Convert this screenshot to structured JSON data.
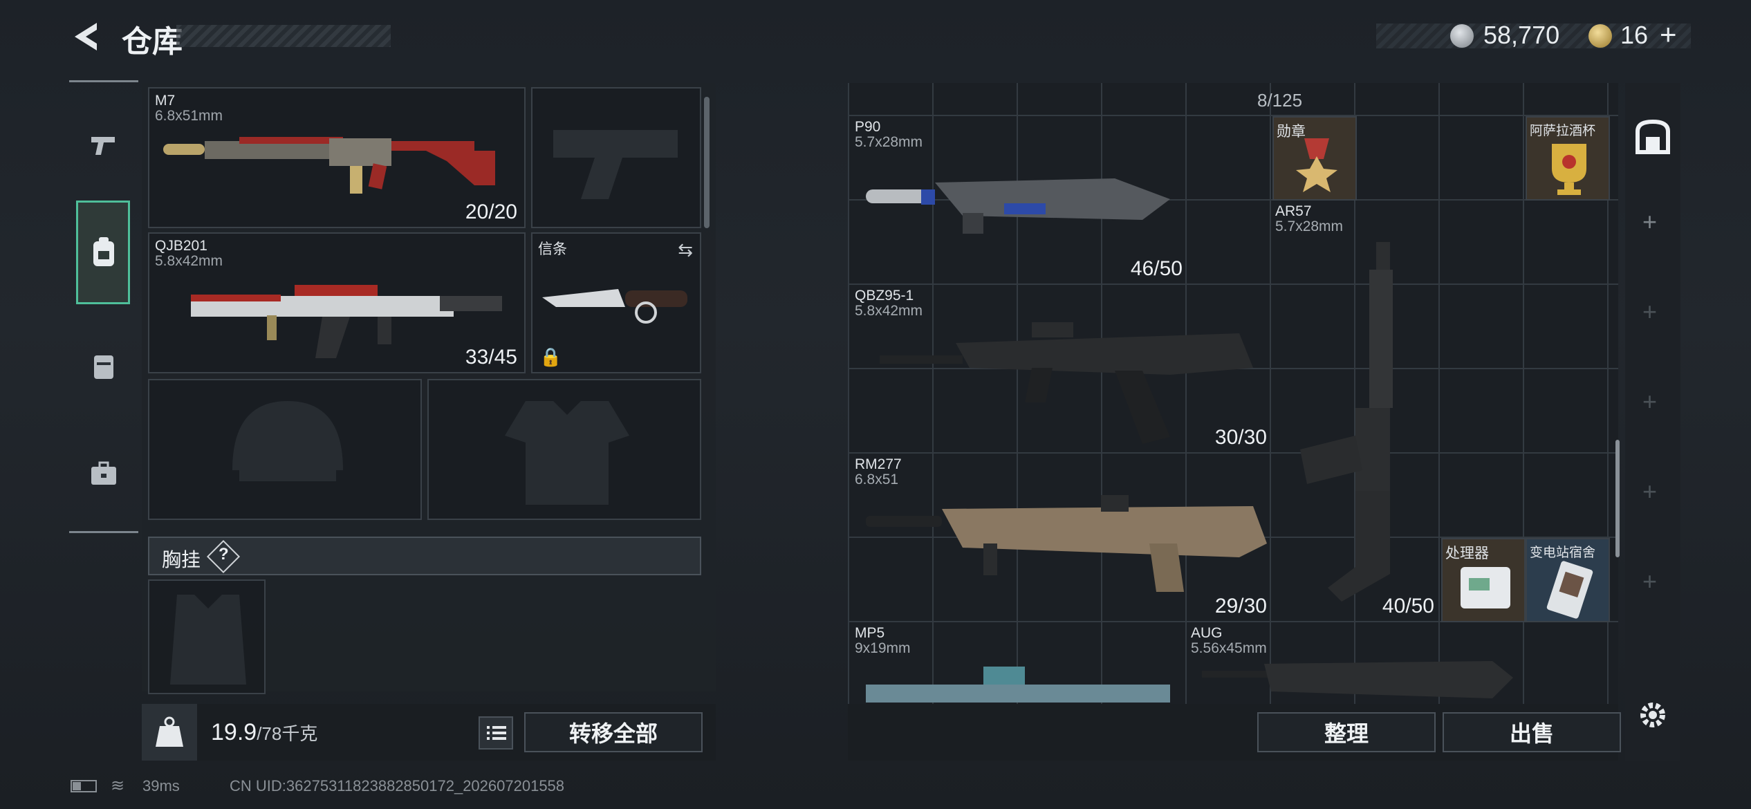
{
  "header": {
    "title": "仓库"
  },
  "currency": {
    "coins": "58,770",
    "tokens": "16",
    "tokens_plus": "+"
  },
  "loadout": {
    "primary": {
      "name": "M7",
      "caliber": "6.8x51mm",
      "ammo": "20/20"
    },
    "secondary": {
      "name": "QJB201",
      "caliber": "5.8x42mm",
      "ammo": "33/45"
    },
    "melee": {
      "label": "信条"
    },
    "chest_rig": {
      "label": "胸挂",
      "help": "?"
    }
  },
  "weight": {
    "current": "19.9",
    "max": "/78千克"
  },
  "buttons": {
    "transfer_all": "转移全部",
    "organize": "整理",
    "sell": "出售"
  },
  "stash": {
    "capacity": "8/125",
    "items": [
      {
        "name": "P90",
        "caliber": "5.7x28mm",
        "ammo": "46/50"
      },
      {
        "name": "QBZ95-1",
        "caliber": "5.8x42mm",
        "ammo": "30/30"
      },
      {
        "name": "RM277",
        "caliber": "6.8x51",
        "ammo": "29/30"
      },
      {
        "name": "MP5",
        "caliber": "9x19mm"
      },
      {
        "name": "AR57",
        "caliber": "5.7x28mm",
        "ammo": "40/50"
      },
      {
        "name": "AUG",
        "caliber": "5.56x45mm"
      },
      {
        "name": "勋章"
      },
      {
        "name": "阿萨拉酒杯"
      },
      {
        "name": "处理器"
      },
      {
        "name": "变电站宿舍"
      }
    ]
  },
  "footer": {
    "ping": "39ms",
    "uid": "CN UID:3627531182388285017​2_202607201558"
  }
}
